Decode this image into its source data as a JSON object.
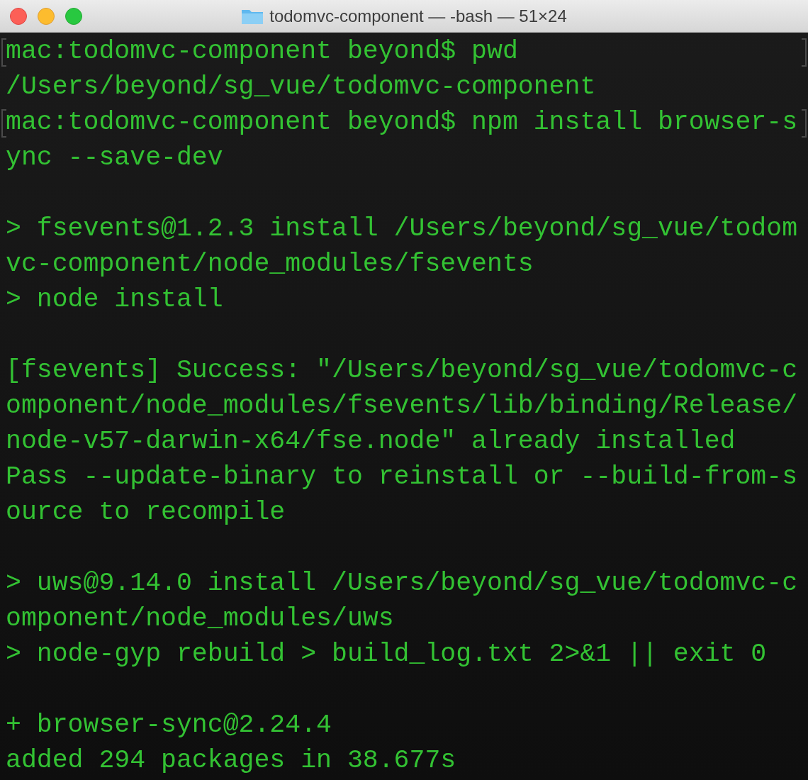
{
  "window": {
    "title": "todomvc-component — -bash — 51×24"
  },
  "lines": [
    {
      "kind": "text",
      "text": "mac:todomvc-component beyond$ pwd",
      "marked": true
    },
    {
      "kind": "text",
      "text": "/Users/beyond/sg_vue/todomvc-component",
      "marked": false
    },
    {
      "kind": "text",
      "text": "mac:todomvc-component beyond$ npm install browser-s",
      "marked": true
    },
    {
      "kind": "text",
      "text": "ync --save-dev",
      "marked": false
    },
    {
      "kind": "blank"
    },
    {
      "kind": "text",
      "text": "> fsevents@1.2.3 install /Users/beyond/sg_vue/todom",
      "marked": false
    },
    {
      "kind": "text",
      "text": "vc-component/node_modules/fsevents",
      "marked": false
    },
    {
      "kind": "text",
      "text": "> node install",
      "marked": false
    },
    {
      "kind": "blank"
    },
    {
      "kind": "text",
      "text": "[fsevents] Success: \"/Users/beyond/sg_vue/todomvc-c",
      "marked": false
    },
    {
      "kind": "text",
      "text": "omponent/node_modules/fsevents/lib/binding/Release/",
      "marked": false
    },
    {
      "kind": "text",
      "text": "node-v57-darwin-x64/fse.node\" already installed",
      "marked": false
    },
    {
      "kind": "text",
      "text": "Pass --update-binary to reinstall or --build-from-s",
      "marked": false
    },
    {
      "kind": "text",
      "text": "ource to recompile",
      "marked": false
    },
    {
      "kind": "blank"
    },
    {
      "kind": "text",
      "text": "> uws@9.14.0 install /Users/beyond/sg_vue/todomvc-c",
      "marked": false
    },
    {
      "kind": "text",
      "text": "omponent/node_modules/uws",
      "marked": false
    },
    {
      "kind": "text",
      "text": "> node-gyp rebuild > build_log.txt 2>&1 || exit 0",
      "marked": false
    },
    {
      "kind": "blank"
    },
    {
      "kind": "text",
      "text": "+ browser-sync@2.24.4",
      "marked": false
    },
    {
      "kind": "text",
      "text": "added 294 packages in 38.677s",
      "marked": false
    }
  ]
}
